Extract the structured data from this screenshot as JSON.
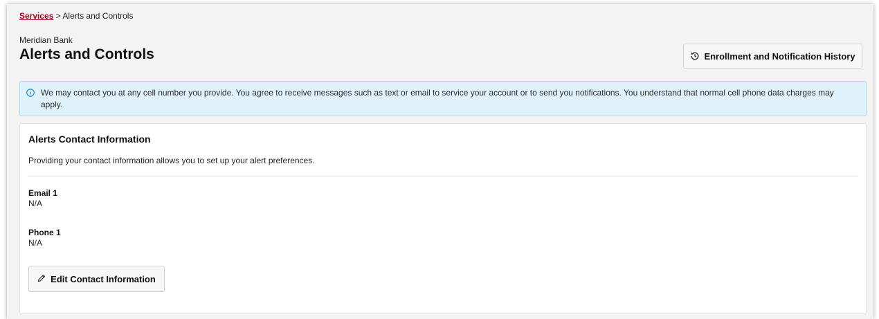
{
  "breadcrumb": {
    "link_label": "Services",
    "separator": ">",
    "current": "Alerts and Controls"
  },
  "header": {
    "bank_name": "Meridian Bank",
    "title": "Alerts and Controls",
    "history_button_label": "Enrollment and Notification History",
    "history_icon": "history-icon"
  },
  "banner": {
    "icon": "info-icon",
    "text": "We may contact you at any cell number you provide. You agree to receive messages such as text or email to service your account or to send you notifications. You understand that normal cell phone data charges may apply."
  },
  "contact_card": {
    "title": "Alerts Contact Information",
    "description": "Providing your contact information allows you to set up your alert preferences.",
    "fields": [
      {
        "label": "Email 1",
        "value": "N/A"
      },
      {
        "label": "Phone 1",
        "value": "N/A"
      }
    ],
    "edit_button_label": "Edit Contact Information",
    "edit_icon": "pencil-icon"
  },
  "colors": {
    "link": "#b00020",
    "banner_bg": "#dff2fb",
    "banner_border": "#a9d9f0",
    "info_icon": "#1a7fc1"
  }
}
